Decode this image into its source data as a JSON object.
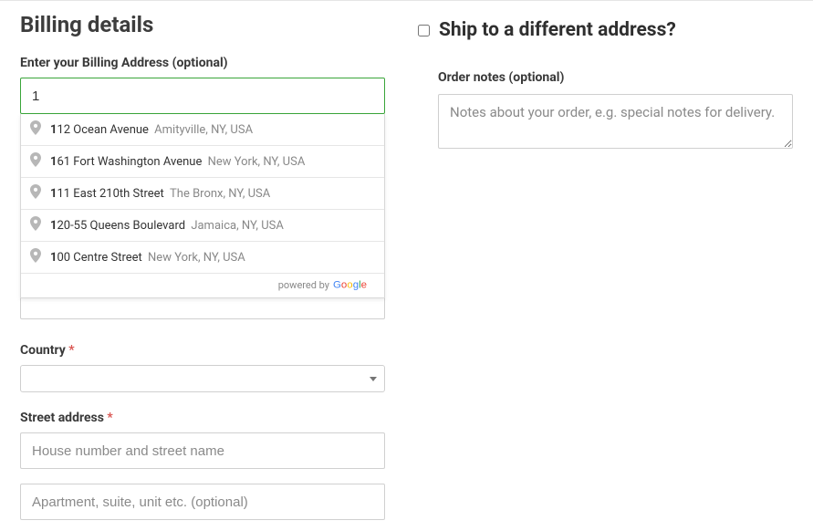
{
  "billing": {
    "title": "Billing details",
    "address_label": "Enter your Billing Address (optional)",
    "address_value": "1",
    "suggestions": [
      {
        "bold": "1",
        "main": "12 Ocean Avenue",
        "secondary": "Amityville, NY, USA"
      },
      {
        "bold": "1",
        "main": "61 Fort Washington Avenue",
        "secondary": "New York, NY, USA"
      },
      {
        "bold": "1",
        "main": "11 East 210th Street",
        "secondary": "The Bronx, NY, USA"
      },
      {
        "bold": "1",
        "main": "20-55 Queens Boulevard",
        "secondary": "Jamaica, NY, USA"
      },
      {
        "bold": "1",
        "main": "00 Centre Street",
        "secondary": "New York, NY, USA"
      }
    ],
    "powered_by": "powered by",
    "country_label": "Country",
    "street_label": "Street address",
    "street_placeholder_1": "House number and street name",
    "street_placeholder_2": "Apartment, suite, unit etc. (optional)"
  },
  "shipping": {
    "ship_different_label": "Ship to a different address?",
    "notes_label": "Order notes (optional)",
    "notes_placeholder": "Notes about your order, e.g. special notes for delivery."
  }
}
